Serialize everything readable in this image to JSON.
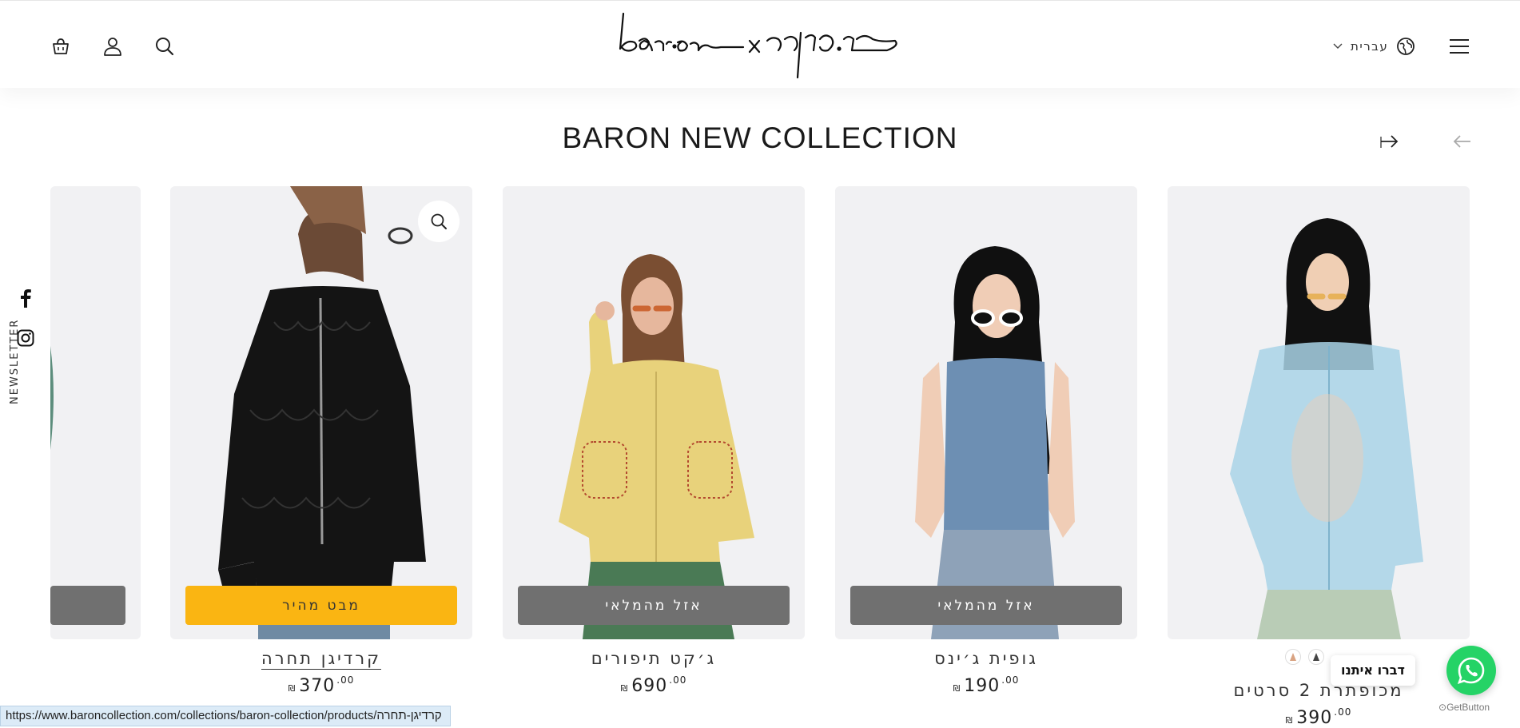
{
  "header": {
    "language": "עברית",
    "icons": [
      "cart-icon",
      "account-icon",
      "search-icon",
      "globe-icon",
      "menu-icon"
    ]
  },
  "collection": {
    "title": "BARON NEW COLLECTION"
  },
  "side": {
    "newsletter": "NEWSLETTER"
  },
  "products": [
    {
      "name": "מכופתרת 2 סרטים",
      "price": "390",
      "cents": ".00",
      "currency": "₪",
      "button": ""
    },
    {
      "name": "גופית ג׳ינס",
      "price": "190",
      "cents": ".00",
      "currency": "₪",
      "button": "אזל מהמלאי"
    },
    {
      "name": "ג׳קט תיפורים",
      "price": "690",
      "cents": ".00",
      "currency": "₪",
      "button": "אזל מהמלאי"
    },
    {
      "name": "קרדיגן תחרה",
      "price": "370",
      "cents": ".00",
      "currency": "₪",
      "button": "מבט מהיר"
    }
  ],
  "whatsapp": {
    "label": "דברו איתנו",
    "credit": "GetButton"
  },
  "status_bar": {
    "url": "https://www.baroncollection.com/collections/baron-collection/products/קרדיגן-תחרה"
  },
  "colors": {
    "quick_view": "#fab512",
    "sold_out": "#707070",
    "whatsapp": "#25d366"
  }
}
